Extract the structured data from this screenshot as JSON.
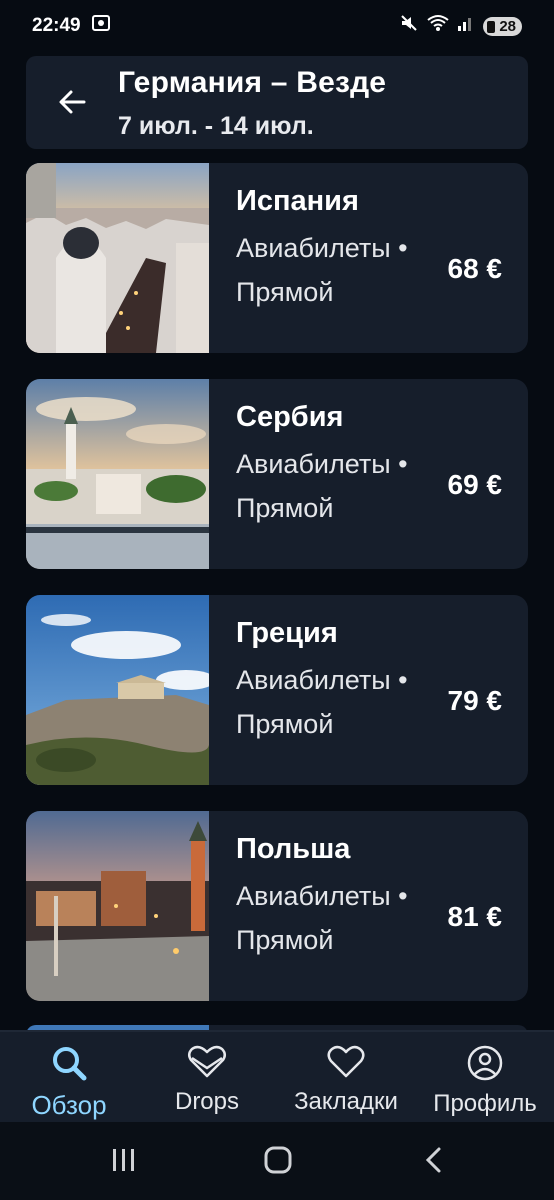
{
  "status": {
    "time": "22:49",
    "battery": "28"
  },
  "header": {
    "title": "Германия – Везде",
    "dates": "7 июл. - 14 июл."
  },
  "results": [
    {
      "country": "Испания",
      "type": "Авиабилеты •",
      "stops": "Прямой",
      "price": "68 €"
    },
    {
      "country": "Сербия",
      "type": "Авиабилеты •",
      "stops": "Прямой",
      "price": "69 €"
    },
    {
      "country": "Греция",
      "type": "Авиабилеты •",
      "stops": "Прямой",
      "price": "79 €"
    },
    {
      "country": "Польша",
      "type": "Авиабилеты •",
      "stops": "Прямой",
      "price": "81 €"
    }
  ],
  "nav": {
    "explore": "Обзор",
    "drops": "Drops",
    "bookmarks": "Закладки",
    "profile": "Профиль"
  },
  "colors": {
    "accent": "#8fd6ff",
    "card": "#161e2b",
    "background": "#060b12"
  }
}
